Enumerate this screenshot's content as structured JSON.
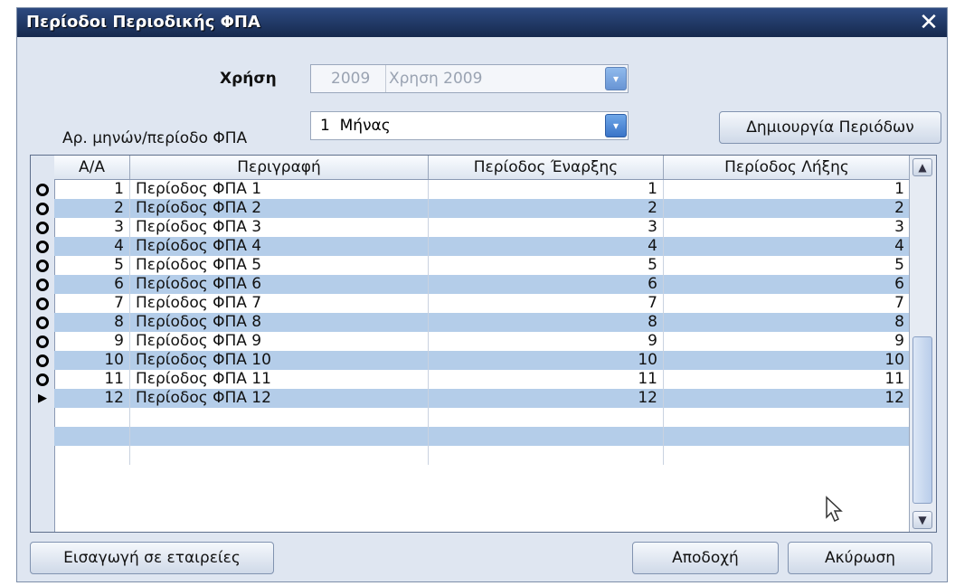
{
  "window": {
    "title": "Περίοδοι Περιοδικής ΦΠΑ",
    "close_glyph": "✕"
  },
  "form": {
    "year_label": "Χρήση",
    "year_code": "2009",
    "year_desc": "Χρηση 2009",
    "months_label": "Αρ. μηνών/περίοδο ΦΠΑ",
    "months_value": "1  Μήνας",
    "create_button": "Δημιουργία Περιόδων"
  },
  "grid": {
    "columns": [
      "Α/Α",
      "Περιγραφή",
      "Περίοδος Έναρξης",
      "Περίοδος Λήξης"
    ],
    "rows": [
      {
        "aa": "1",
        "desc": "Περίοδος ΦΠΑ 1",
        "start": "1",
        "end": "1"
      },
      {
        "aa": "2",
        "desc": "Περίοδος ΦΠΑ 2",
        "start": "2",
        "end": "2"
      },
      {
        "aa": "3",
        "desc": "Περίοδος ΦΠΑ 3",
        "start": "3",
        "end": "3"
      },
      {
        "aa": "4",
        "desc": "Περίοδος ΦΠΑ 4",
        "start": "4",
        "end": "4"
      },
      {
        "aa": "5",
        "desc": "Περίοδος ΦΠΑ 5",
        "start": "5",
        "end": "5"
      },
      {
        "aa": "6",
        "desc": "Περίοδος ΦΠΑ 6",
        "start": "6",
        "end": "6"
      },
      {
        "aa": "7",
        "desc": "Περίοδος ΦΠΑ 7",
        "start": "7",
        "end": "7"
      },
      {
        "aa": "8",
        "desc": "Περίοδος ΦΠΑ 8",
        "start": "8",
        "end": "8"
      },
      {
        "aa": "9",
        "desc": "Περίοδος ΦΠΑ 9",
        "start": "9",
        "end": "9"
      },
      {
        "aa": "10",
        "desc": "Περίοδος ΦΠΑ 10",
        "start": "10",
        "end": "10"
      },
      {
        "aa": "11",
        "desc": "Περίοδος ΦΠΑ 11",
        "start": "11",
        "end": "11"
      },
      {
        "aa": "12",
        "desc": "Περίοδος ΦΠΑ 12",
        "start": "12",
        "end": "12"
      }
    ]
  },
  "footer": {
    "import_button": "Εισαγωγή σε εταιρείες",
    "accept_button": "Αποδοχή",
    "cancel_button": "Ακύρωση"
  },
  "colors": {
    "title_bar": "#1e3564",
    "alt_row": "#b4cde9",
    "dialog_bg": "#dfe6f1"
  }
}
